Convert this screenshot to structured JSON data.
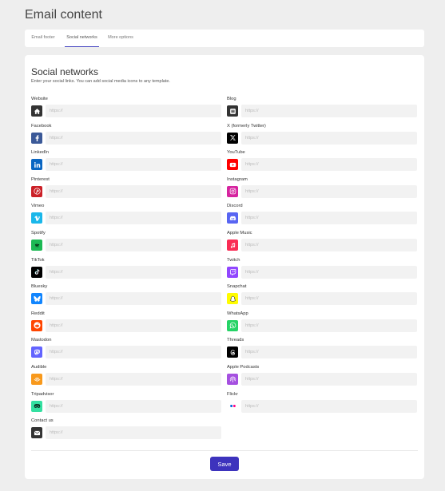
{
  "header": {
    "title": "Email content"
  },
  "tabs": [
    {
      "label": "Email footer"
    },
    {
      "label": "Social networks"
    },
    {
      "label": "More options"
    }
  ],
  "section": {
    "title": "Social networks",
    "description": "Enter your social links. You can add social media icons to any template."
  },
  "input_placeholder": "https://",
  "fields_left": [
    {
      "label": "Website",
      "icon": "home-icon",
      "color": "#333333",
      "value": ""
    },
    {
      "label": "Facebook",
      "icon": "facebook-icon",
      "color": "#3b5998",
      "value": ""
    },
    {
      "label": "LinkedIn",
      "icon": "linkedin-icon",
      "color": "#0a66c2",
      "value": ""
    },
    {
      "label": "Pinterest",
      "icon": "pinterest-icon",
      "color": "#cb2027",
      "value": ""
    },
    {
      "label": "Vimeo",
      "icon": "vimeo-icon",
      "color": "#1ab7ea",
      "value": ""
    },
    {
      "label": "Spotify",
      "icon": "spotify-icon",
      "color": "#1db954",
      "value": ""
    },
    {
      "label": "TikTok",
      "icon": "tiktok-icon",
      "color": "#000000",
      "value": ""
    },
    {
      "label": "Bluesky",
      "icon": "bluesky-icon",
      "color": "#1185fe",
      "value": ""
    },
    {
      "label": "Reddit",
      "icon": "reddit-icon",
      "color": "#ff4500",
      "value": ""
    },
    {
      "label": "Mastodon",
      "icon": "mastodon-icon",
      "color": "#6364ff",
      "value": ""
    },
    {
      "label": "Audible",
      "icon": "audible-icon",
      "color": "#f8991c",
      "value": ""
    },
    {
      "label": "Tripadvisor",
      "icon": "tripadvisor-icon",
      "color": "#34e0a1",
      "value": ""
    },
    {
      "label": "Contact us",
      "icon": "mail-icon",
      "color": "#333333",
      "value": ""
    }
  ],
  "fields_right": [
    {
      "label": "Blog",
      "icon": "blog-icon",
      "color": "#333333",
      "value": ""
    },
    {
      "label": "X (formerly Twitter)",
      "icon": "x-icon",
      "color": "#000000",
      "value": ""
    },
    {
      "label": "YouTube",
      "icon": "youtube-icon",
      "color": "#ff0000",
      "value": ""
    },
    {
      "label": "Instagram",
      "icon": "instagram-icon",
      "color": "#d6249f",
      "value": ""
    },
    {
      "label": "Discord",
      "icon": "discord-icon",
      "color": "#5865f2",
      "value": ""
    },
    {
      "label": "Apple Music",
      "icon": "apple-music-icon",
      "color": "#fa2d55",
      "value": ""
    },
    {
      "label": "Twitch",
      "icon": "twitch-icon",
      "color": "#9146ff",
      "value": ""
    },
    {
      "label": "Snapchat",
      "icon": "snapchat-icon",
      "color": "#fffc00",
      "value": ""
    },
    {
      "label": "WhatsApp",
      "icon": "whatsapp-icon",
      "color": "#25d366",
      "value": ""
    },
    {
      "label": "Threads",
      "icon": "threads-icon",
      "color": "#000000",
      "value": ""
    },
    {
      "label": "Apple Podcasts",
      "icon": "apple-podcasts-icon",
      "color": "#a550e0",
      "value": ""
    },
    {
      "label": "Flickr",
      "icon": "flickr-icon",
      "color": "#ffffff",
      "value": ""
    }
  ],
  "actions": {
    "save_label": "Save"
  },
  "colors": {
    "accent": "#3d33bd",
    "background": "#eeeeee",
    "input_bg": "#f2f2f2"
  }
}
